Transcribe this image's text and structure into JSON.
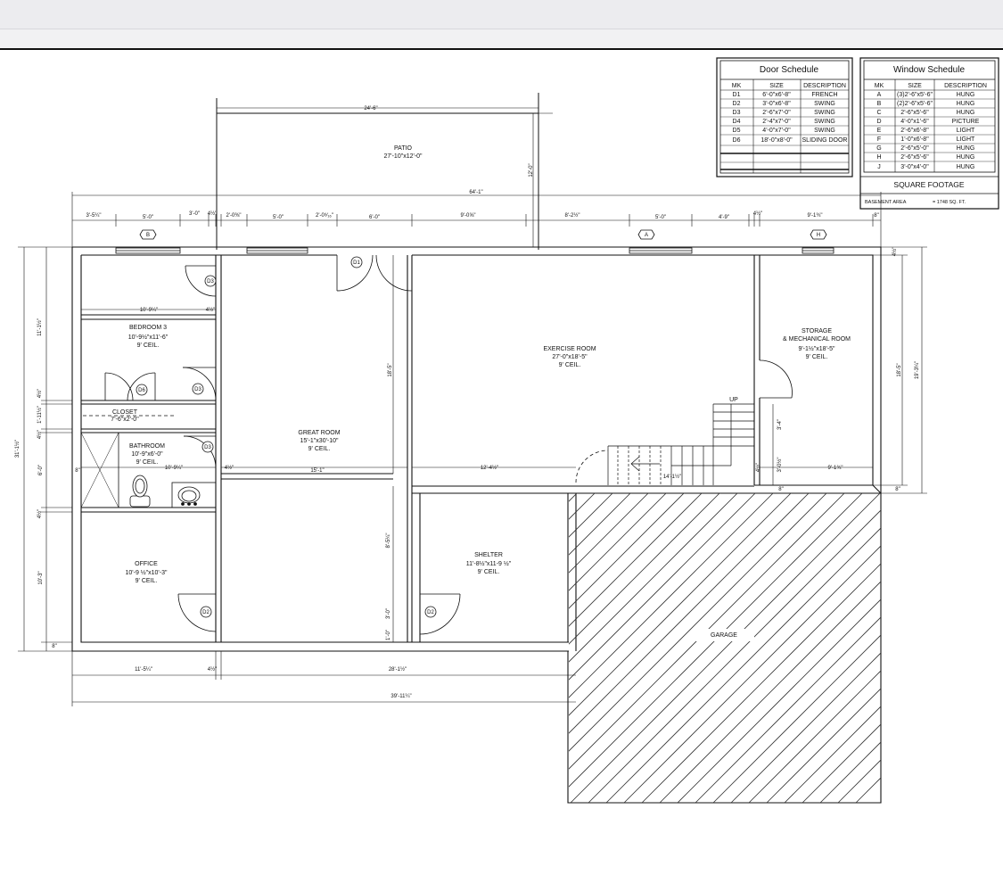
{
  "door_schedule": {
    "title": "Door Schedule",
    "headers": [
      "MK",
      "SIZE",
      "DESCRIPTION"
    ],
    "rows": [
      [
        "D1",
        "6'-0\"x6'-8\"",
        "FRENCH"
      ],
      [
        "D2",
        "3'-0\"x6'-8\"",
        "SWING"
      ],
      [
        "D3",
        "2'-6\"x7'-0\"",
        "SWING"
      ],
      [
        "D4",
        "2'-4\"x7'-0\"",
        "SWING"
      ],
      [
        "D5",
        "4'-0\"x7'-0\"",
        "SWING"
      ],
      [
        "D6",
        "18'-0\"x8'-0\"",
        "SLIDING DOOR"
      ]
    ]
  },
  "window_schedule": {
    "title": "Window  Schedule",
    "headers": [
      "MK",
      "SIZE",
      "DESCRIPTION"
    ],
    "rows": [
      [
        "A",
        "(3)2'-6\"x5'-6\"",
        "HUNG"
      ],
      [
        "B",
        "(2)2'-6\"x5'-6\"",
        "HUNG"
      ],
      [
        "C",
        "2'-6\"x5'-6\"",
        "HUNG"
      ],
      [
        "D",
        "4'-0\"x1'-6\"",
        "PICTURE"
      ],
      [
        "E",
        "2'-6\"x6'-8\"",
        "LIGHT"
      ],
      [
        "F",
        "1'-0\"x6'-8\"",
        "LIGHT"
      ],
      [
        "G",
        "2'-6\"x5'-0\"",
        "HUNG"
      ],
      [
        "H",
        "2'-6\"x5'-6\"",
        "HUNG"
      ],
      [
        "J",
        "3'-0\"x4'-0\"",
        "HUNG"
      ]
    ]
  },
  "square_footage": {
    "title": "SQUARE FOOTAGE",
    "label": "BASEMENT AREA",
    "value": "= 1748 SQ. FT."
  },
  "rooms": {
    "patio": {
      "name": "PATIO",
      "size": "27'-10\"x12'-0\""
    },
    "bedroom3": {
      "name": "BEDROOM 3",
      "size": "10'-9½\"x11'-6\"",
      "ceil": "9' CEIL."
    },
    "closet": {
      "name": "CLOSET",
      "size": "7'-6\"x2'-0\""
    },
    "bathroom": {
      "name": "BATHROOM",
      "size": "10'-9\"x6'-0\"",
      "ceil": "9' CEIL."
    },
    "office": {
      "name": "OFFICE",
      "size": "10'-9 ½\"x10'-3\"",
      "ceil": "9' CEIL."
    },
    "great_room": {
      "name": "GREAT ROOM",
      "size": "15'-1\"x30'-10\"",
      "ceil": "9' CEIL."
    },
    "exercise_room": {
      "name": "EXERCISE ROOM",
      "size": "27'-0\"x18'-5\"",
      "ceil": "9' CEIL."
    },
    "storage": {
      "name": "STORAGE",
      "name2": "& MECHANICAL ROOM",
      "size": "9'-1½\"x18'-5\"",
      "ceil": "9' CEIL."
    },
    "shelter": {
      "name": "SHELTER",
      "size": "11'-8½\"x11-9 ½\"",
      "ceil": "9' CEIL."
    },
    "garage": {
      "name": "GARAGE"
    },
    "stair_up": "UP"
  },
  "door_tags": {
    "d1": "D1",
    "d2": "D2",
    "d3": "D3",
    "d6": "D6"
  },
  "window_tags": {
    "b": "B",
    "a": "A",
    "h": "H"
  },
  "dims": {
    "patio_width": "24'-6\"",
    "patio_depth": "12'-0\"",
    "overall_top": "64'-1\"",
    "t1": "3'-5¼\"",
    "t2": "5'-0\"",
    "t3": "3'-0\"",
    "t4": "4½\"",
    "t5": "2'-0⅜\"",
    "t6": "5'-0\"",
    "t7": "2'-0⁹⁄₁₆\"",
    "t8": "6'-0\"",
    "t9": "9'-0⅝\"",
    "t10": "8'-2½\"",
    "t11": "5'-0\"",
    "t12": "4'-9\"",
    "t13": "4½\"",
    "t14": "9'-1¾\"",
    "t15": "8\"",
    "left_total": "31'-1½\"",
    "left_upper": "11'-1½\"",
    "left_a": "4½\"",
    "left_b": "1'-11½\"",
    "left_c": "4½\"",
    "left_d": "6'-0\"",
    "left_e": "4½\"",
    "left_f": "10'-3\"",
    "left_g": "8\"",
    "bed_width": "10'-9¼\"",
    "bed_wall": "4½\"",
    "bath_width": "10'-9¼\"",
    "bath_wall": "4½\"",
    "bath_8": "8\"",
    "gr_width": "15'-1\"",
    "gr_depth": "18'-5\"",
    "ex_width": "12'-4½\"",
    "stair_w": "14'-1½\"",
    "storage_w": "9'-1¾\"",
    "stor_v1": "3'-4\"",
    "stor_v2": "3'-0½\"",
    "stor_v3": "4½\"",
    "stor_v4": "8\"",
    "right_total": "19'-3¼\"",
    "right_a": "18'-5\"",
    "right_b": "4½\"",
    "right_c": "8\"",
    "shelter_v": "8'-5¼\"",
    "shelter_d1": "3'-0\"",
    "shelter_d2": "1'-0\"",
    "bot_1": "11'-5¼\"",
    "bot_2": "4½\"",
    "bot_3": "28'-1½\"",
    "bot_total": "39'-11¼\""
  }
}
